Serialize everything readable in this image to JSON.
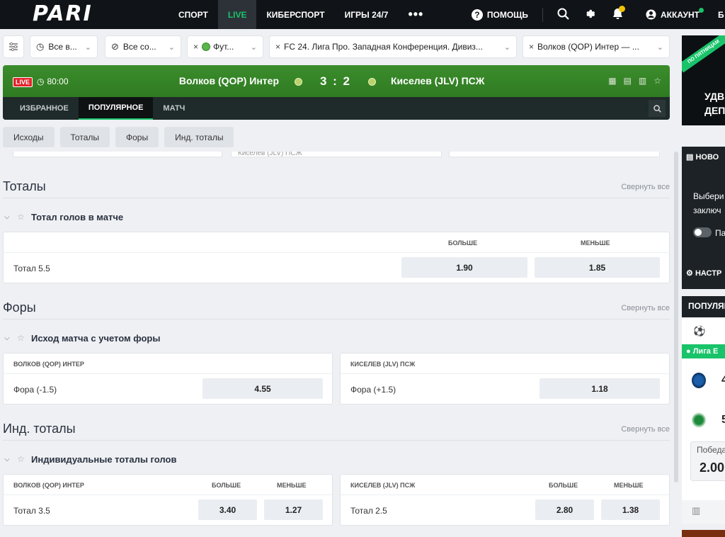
{
  "header": {
    "logo": "PARI",
    "nav": [
      {
        "label": "Спорт",
        "active": false
      },
      {
        "label": "LIVE",
        "active": true
      },
      {
        "label": "Киберспорт",
        "active": false
      },
      {
        "label": "Игры 24/7",
        "active": false
      }
    ],
    "more": "•••",
    "help_label": "ПОМОЩЬ",
    "account_label": "АККАУНТ",
    "right_cut": "Б"
  },
  "filters": {
    "all_v": "Все в...",
    "all_so": "Все со...",
    "football": "Фут...",
    "league": "FC 24. Лига Про. Западная Конференция. Дивиз...",
    "match": "Волков (QOP) Интер — ..."
  },
  "match": {
    "live_badge": "LIVE",
    "time": "80:00",
    "team1": "Волков (QOP) Интер",
    "team2": "Киселев (JLV) ПСЖ",
    "score": "3 : 2",
    "tabs": [
      {
        "label": "Избранное",
        "active": false
      },
      {
        "label": "Популярное",
        "active": true
      },
      {
        "label": "Матч",
        "active": false
      }
    ]
  },
  "chips": [
    "Исходы",
    "Тоталы",
    "Форы",
    "Инд. тоталы"
  ],
  "ghost_text": "Киселев (JLV) ПСЖ",
  "sections": {
    "totals": {
      "title": "Тоталы",
      "collapse": "Свернуть все",
      "market": "Тотал голов в матче",
      "col_over": "Больше",
      "col_under": "Меньше",
      "row_label": "Тотал 5.5",
      "over": "1.90",
      "under": "1.85"
    },
    "handicap": {
      "title": "Форы",
      "collapse": "Свернуть все",
      "market": "Исход матча с учетом форы",
      "team1_head": "Волков (QOP) Интер",
      "team2_head": "Киселев (JLV) ПСЖ",
      "row1_label": "Фора (-1.5)",
      "row1_odd": "4.55",
      "row2_label": "Фора (+1.5)",
      "row2_odd": "1.18"
    },
    "ind_totals": {
      "title": "Инд. тоталы",
      "collapse": "Свернуть все",
      "market": "Индивидуальные тоталы голов",
      "team1_head": "Волков (QOP) Интер",
      "team2_head": "Киселев (JLV) ПСЖ",
      "col_over": "Больше",
      "col_under": "Меньше",
      "row1_label": "Тотал 3.5",
      "row1_over": "3.40",
      "row1_under": "1.27",
      "row2_label": "Тотал 2.5",
      "row2_over": "2.80",
      "row2_under": "1.38"
    }
  },
  "right_panel": {
    "promo_stripe": "ПО ПЯТНИЦАМ",
    "promo_line1": "УДВ",
    "promo_line2": "ДЕП",
    "news_head": "НОВО",
    "news_line1": "Выбери",
    "news_line2": "заключ",
    "toggle_label": "Па",
    "settings": "НАСТР",
    "popular_head": "ПОПУЛЯР",
    "league": "Лига Е",
    "score1": "4",
    "score2": "5",
    "win_label": "Победа",
    "win_odd": "2.00"
  }
}
